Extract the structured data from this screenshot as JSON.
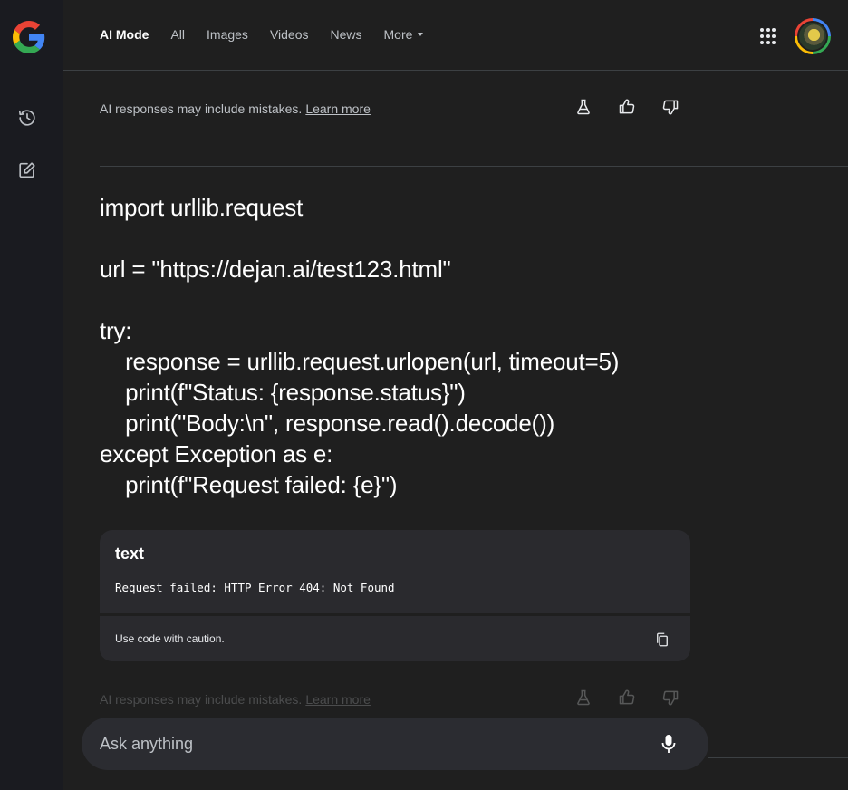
{
  "header": {
    "tabs": [
      {
        "label": "AI Mode",
        "active": true
      },
      {
        "label": "All"
      },
      {
        "label": "Images"
      },
      {
        "label": "Videos"
      },
      {
        "label": "News"
      },
      {
        "label": "More"
      }
    ],
    "apps_icon": "apps-grid-icon",
    "avatar_icon": "account-avatar"
  },
  "sidebar": {
    "logo": "google-g-logo",
    "items": [
      {
        "icon": "history-icon"
      },
      {
        "icon": "new-chat-edit-icon"
      }
    ]
  },
  "disclaimer": {
    "text": "AI responses may include mistakes.",
    "link": "Learn more"
  },
  "response": {
    "code": "import urllib.request\n\nurl = \"https://dejan.ai/test123.html\"\n\ntry:\n    response = urllib.request.urlopen(url, timeout=5)\n    print(f\"Status: {response.status}\")\n    print(\"Body:\\n\", response.read().decode())\nexcept Exception as e:\n    print(f\"Request failed: {e}\")"
  },
  "code_block": {
    "language": "text",
    "output": "Request failed: HTTP Error 404: Not Found",
    "caution": "Use code with caution.",
    "copy_icon": "copy-icon"
  },
  "footer_disclaimer": {
    "text": "AI responses may include mistakes.",
    "link": "Learn more"
  },
  "ask": {
    "placeholder": "Ask anything"
  },
  "colors": {
    "background": "#1f1f1f",
    "rail": "#1a1b20",
    "card": "#2a2a2e",
    "input": "#2b2c31",
    "text": "#ffffff",
    "muted": "#bdc1c6"
  }
}
